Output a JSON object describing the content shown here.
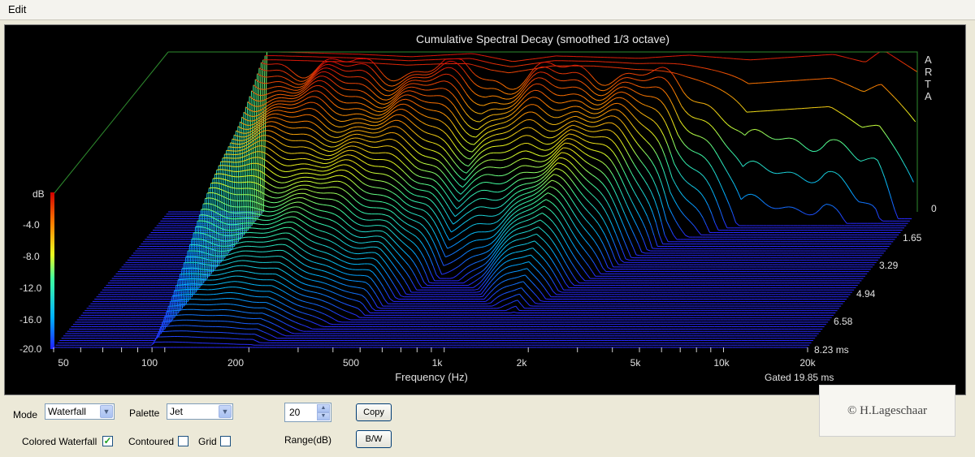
{
  "menu": {
    "edit_label": "Edit"
  },
  "plot": {
    "title": "Cumulative Spectral Decay (smoothed 1/3 octave)",
    "brand_letters": [
      "A",
      "R",
      "T",
      "A"
    ],
    "db_axis_label": "dB",
    "db_ticks": [
      "-4.0",
      "-8.0",
      "-12.0",
      "-16.0",
      "-20.0"
    ],
    "freq_ticks": [
      "50",
      "100",
      "200",
      "500",
      "1k",
      "2k",
      "5k",
      "10k",
      "20k"
    ],
    "freq_axis_label": "Frequency (Hz)",
    "time_ticks": [
      "0",
      "1.65",
      "3.29",
      "4.94",
      "6.58",
      "8.23 ms"
    ],
    "gated_label": "Gated 19.85 ms"
  },
  "chart_data": {
    "type": "waterfall",
    "title": "Cumulative Spectral Decay (smoothed 1/3 octave)",
    "xlabel": "Frequency (Hz)",
    "x_scale": "log",
    "xlim": [
      40,
      20000
    ],
    "zlabel": "dB",
    "zlim": [
      -20,
      0
    ],
    "time_axis_ms": [
      0,
      1.65,
      3.29,
      4.94,
      6.58,
      8.23
    ],
    "gate_ms": 19.85,
    "palette": "Jet",
    "slices": 60,
    "first_slice_db": [
      {
        "f": 100,
        "db": 0.0
      },
      {
        "f": 200,
        "db": -0.3
      },
      {
        "f": 300,
        "db": -0.6
      },
      {
        "f": 500,
        "db": -0.2
      },
      {
        "f": 700,
        "db": -1.2
      },
      {
        "f": 1000,
        "db": -0.5
      },
      {
        "f": 2000,
        "db": -0.8
      },
      {
        "f": 3000,
        "db": -0.4
      },
      {
        "f": 5000,
        "db": -1.0
      },
      {
        "f": 10000,
        "db": -0.3
      },
      {
        "f": 13000,
        "db": -1.3
      },
      {
        "f": 15000,
        "db": 0.3
      },
      {
        "f": 20000,
        "db": -2.5
      }
    ],
    "decay_ms": [
      {
        "f": 100,
        "ms": 8.23
      },
      {
        "f": 200,
        "ms": 8.23
      },
      {
        "f": 400,
        "ms": 6.5
      },
      {
        "f": 600,
        "ms": 4.0
      },
      {
        "f": 900,
        "ms": 5.0
      },
      {
        "f": 1400,
        "ms": 6.5
      },
      {
        "f": 2000,
        "ms": 4.5
      },
      {
        "f": 3000,
        "ms": 2.0
      },
      {
        "f": 5000,
        "ms": 0.8
      },
      {
        "f": 10000,
        "ms": 0.8
      },
      {
        "f": 20000,
        "ms": 0.4
      }
    ]
  },
  "controls": {
    "mode_label": "Mode",
    "mode_value": "Waterfall",
    "palette_label": "Palette",
    "palette_value": "Jet",
    "range_value": "20",
    "range_label": "Range(dB)",
    "copy_label": "Copy",
    "bw_label": "B/W",
    "colored_waterfall_label": "Colored Waterfall",
    "colored_waterfall_checked": true,
    "contoured_label": "Contoured",
    "contoured_checked": false,
    "grid_label": "Grid",
    "grid_checked": false
  },
  "watermark": {
    "text": "© H.Lageschaar"
  }
}
